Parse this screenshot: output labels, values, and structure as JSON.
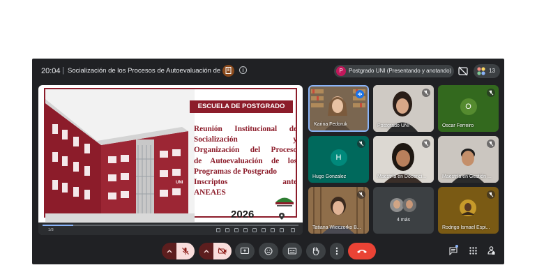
{
  "meeting": {
    "time": "20:04",
    "separator": "|",
    "title": "Socialización de los Procesos de Autoevaluación de ...",
    "info_icon": "info-icon",
    "presenter_initial": "P",
    "presenter_label": "Postgrado UNI (Presentando y anotando)",
    "participant_count": "13"
  },
  "slide": {
    "school": "ESCUELA DE POSTGRADO",
    "lines": [
      "Reunión Institucional de",
      "Socialización          y",
      "Organización del Proceso",
      "de Autoevaluación de los",
      "Programas de Postgrado",
      "Inscriptos          ante",
      "ANEAES"
    ],
    "year": "2026",
    "building_sign": "UNI",
    "page": "1/8",
    "progress": 0.12,
    "colors": {
      "accent": "#8c1c2a"
    }
  },
  "participants": [
    {
      "name": "Karina Fedoruk",
      "kind": "video"
    },
    {
      "name": "Postgrado UNI",
      "kind": "video"
    },
    {
      "name": "Oscar Ferreiro",
      "kind": "avatar",
      "initial": "O",
      "bg": "#33691e",
      "circle": "#558b2f"
    },
    {
      "name": "Hugo Gonzalez",
      "kind": "avatar",
      "initial": "H",
      "bg": "#00695c",
      "circle": "#00897b"
    },
    {
      "name": "Maestría en Docenci...",
      "kind": "video"
    },
    {
      "name": "Maestría en Gestión ...",
      "kind": "video"
    },
    {
      "name": "Tatiana Wieczorko B...",
      "kind": "video"
    },
    {
      "name": "4 más",
      "kind": "more"
    },
    {
      "name": "Rodrigo Ismael Espi...",
      "kind": "video"
    }
  ],
  "controls": {
    "mic": "mic-off-icon",
    "camera": "camera-off-icon",
    "present": "present-screen-icon",
    "emoji": "emoji-icon",
    "captions": "captions-icon",
    "hand": "raise-hand-icon",
    "more": "more-options-icon",
    "leave": "leave-call-icon",
    "chat": "chat-icon",
    "activities": "activities-icon",
    "host": "host-controls-icon",
    "colors": {
      "leave": "#ea4335",
      "muted": "#f9dedc",
      "bar": "#3c4043"
    }
  }
}
